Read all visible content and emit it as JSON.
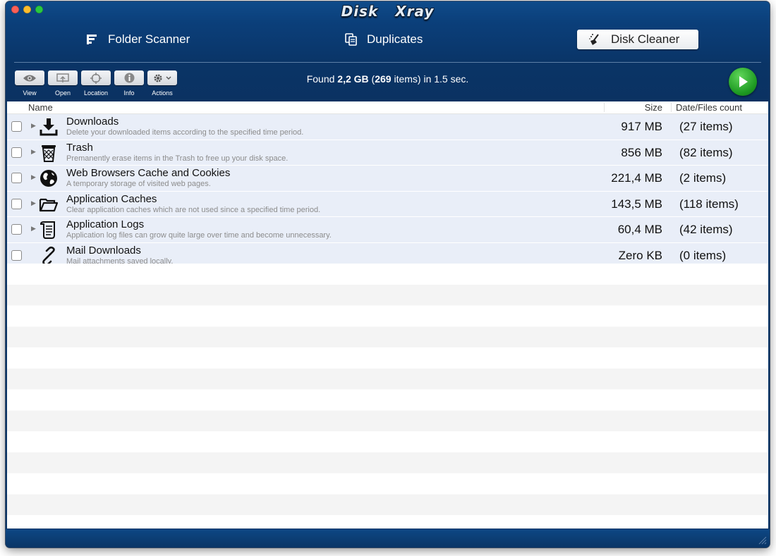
{
  "app": {
    "logo_first": "Disk",
    "logo_second": "Xray"
  },
  "nav": {
    "folder_scanner": "Folder Scanner",
    "duplicates": "Duplicates",
    "disk_cleaner": "Disk Cleaner"
  },
  "toolbar": {
    "view": "View",
    "open": "Open",
    "location": "Location",
    "info": "Info",
    "actions": "Actions"
  },
  "status": {
    "prefix": "Found ",
    "size": "2,2 GB",
    "count_open": " (",
    "count": "269",
    "suffix": " items) in 1.5 sec."
  },
  "table": {
    "headers": {
      "name": "Name",
      "size": "Size",
      "date": "Date/Files count"
    },
    "rows": [
      {
        "title": "Downloads",
        "desc": "Delete your downloaded items according to the specified time period.",
        "size": "917 MB",
        "count": "(27 items)",
        "icon": "download-icon"
      },
      {
        "title": "Trash",
        "desc": "Premanently erase items in the Trash to free up your disk space.",
        "size": "856 MB",
        "count": "(82 items)",
        "icon": "trash-icon"
      },
      {
        "title": "Web Browsers Cache and Cookies",
        "desc": "A temporary storage of visited web pages.",
        "size": "221,4 MB",
        "count": "(2 items)",
        "icon": "globe-icon"
      },
      {
        "title": "Application Caches",
        "desc": "Clear application caches which are not used since a specified time period.",
        "size": "143,5 MB",
        "count": "(118 items)",
        "icon": "folder-icon"
      },
      {
        "title": "Application Logs",
        "desc": "Application log files can grow quite large over time and become unnecessary.",
        "size": "60,4 MB",
        "count": "(42 items)",
        "icon": "log-scroll-icon"
      },
      {
        "title": "Mail Downloads",
        "desc": "Mail attachments saved locally.",
        "size": "Zero KB",
        "count": "(0 items)",
        "icon": "link-icon"
      }
    ]
  },
  "colors": {
    "accent": "#0b3f7a",
    "row_bg": "#e9eef8",
    "play": "#1e9a22"
  }
}
